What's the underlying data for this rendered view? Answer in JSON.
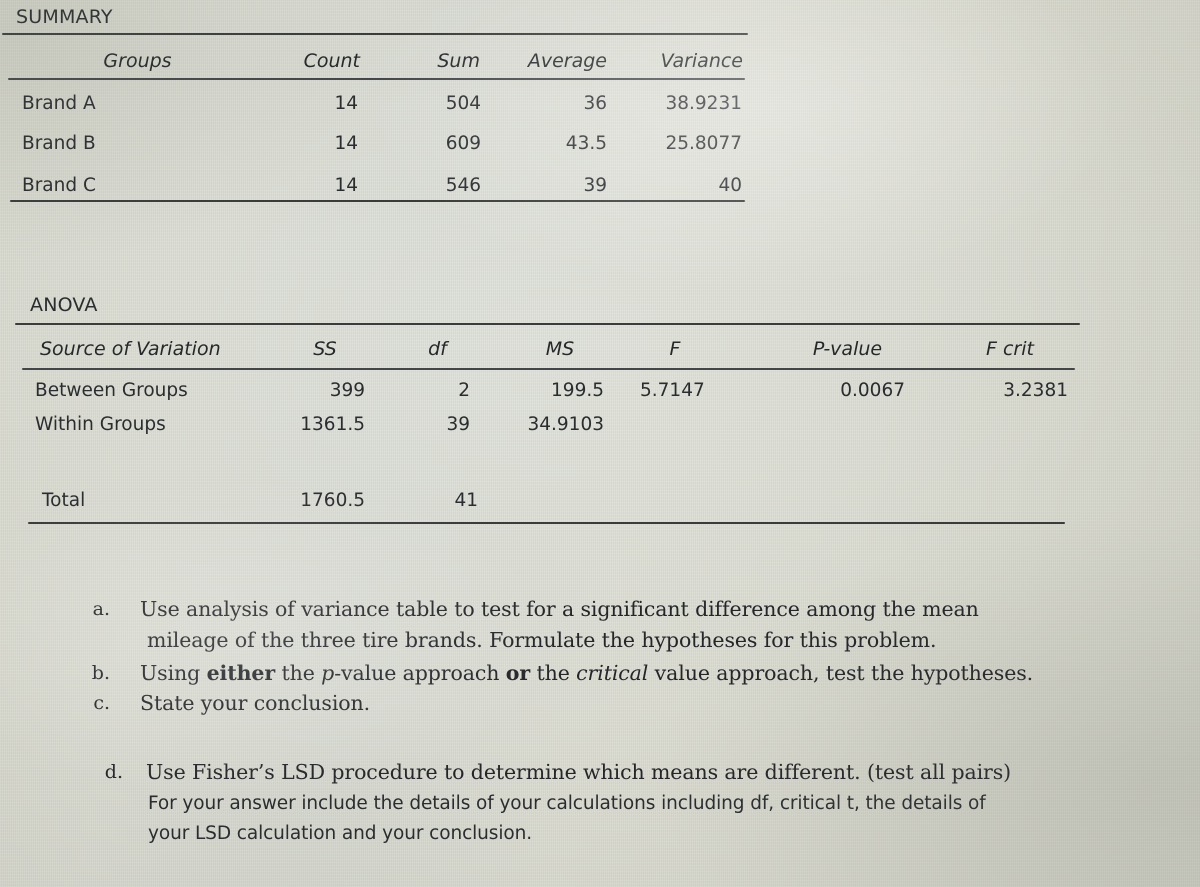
{
  "document": {
    "kind": "spreadsheet-anova-output-photo",
    "background_color": "#dcdbd0",
    "text_color": "#2b2e31",
    "rule_color": "#3a3d3c"
  },
  "summary": {
    "section_label": "SUMMARY",
    "columns": [
      "Groups",
      "Count",
      "Sum",
      "Average",
      "Variance"
    ],
    "rows": [
      {
        "group": "Brand A",
        "count": "14",
        "sum": "504",
        "average": "36",
        "variance": "38.9231"
      },
      {
        "group": "Brand B",
        "count": "14",
        "sum": "609",
        "average": "43.5",
        "variance": "25.8077"
      },
      {
        "group": "Brand C",
        "count": "14",
        "sum": "546",
        "average": "39",
        "variance": "40"
      }
    ]
  },
  "anova": {
    "section_label": "ANOVA",
    "columns": [
      "Source of Variation",
      "SS",
      "df",
      "MS",
      "F",
      "P-value",
      "F crit"
    ],
    "rows": [
      {
        "source": "Between Groups",
        "ss": "399",
        "df": "2",
        "ms": "199.5",
        "f": "5.7147",
        "p_value": "0.0067",
        "f_crit": "3.2381"
      },
      {
        "source": "Within Groups",
        "ss": "1361.5",
        "df": "39",
        "ms": "34.9103",
        "f": "",
        "p_value": "",
        "f_crit": ""
      }
    ],
    "total": {
      "source": "Total",
      "ss": "1760.5",
      "df": "41",
      "ms": "",
      "f": "",
      "p_value": "",
      "f_crit": ""
    }
  },
  "questions": [
    {
      "marker": "a.",
      "lines": [
        {
          "style": "serif",
          "segments": [
            {
              "text": "Use analysis of variance table to test for a significant difference among the mean",
              "emphasis": "none"
            }
          ]
        },
        {
          "style": "serif",
          "segments": [
            {
              "text": "mileage of the three tire brands.  Formulate the hypotheses for this problem.",
              "emphasis": "none"
            }
          ]
        }
      ]
    },
    {
      "marker": "b.",
      "lines": [
        {
          "style": "serif",
          "segments": [
            {
              "text": "Using ",
              "emphasis": "none"
            },
            {
              "text": "either",
              "emphasis": "bold"
            },
            {
              "text": " the ",
              "emphasis": "none"
            },
            {
              "text": "p",
              "emphasis": "italic"
            },
            {
              "text": "-value approach ",
              "emphasis": "none"
            },
            {
              "text": "or",
              "emphasis": "bold"
            },
            {
              "text": " the ",
              "emphasis": "none"
            },
            {
              "text": "critical",
              "emphasis": "italic"
            },
            {
              "text": " value approach, test the hypotheses.",
              "emphasis": "none"
            }
          ]
        }
      ]
    },
    {
      "marker": "c.",
      "lines": [
        {
          "style": "serif",
          "segments": [
            {
              "text": "State your conclusion.",
              "emphasis": "none"
            }
          ]
        }
      ]
    },
    {
      "marker": "d.",
      "lines": [
        {
          "style": "serif",
          "segments": [
            {
              "text": "Use Fisher’s LSD procedure to determine which means are different. (test all pairs)",
              "emphasis": "none"
            }
          ]
        },
        {
          "style": "sans",
          "segments": [
            {
              "text": "For your answer include the details of your calculations including df, critical t, the details of",
              "emphasis": "none"
            }
          ]
        },
        {
          "style": "sans",
          "segments": [
            {
              "text": "your LSD calculation and your conclusion.",
              "emphasis": "none"
            }
          ]
        }
      ]
    }
  ]
}
